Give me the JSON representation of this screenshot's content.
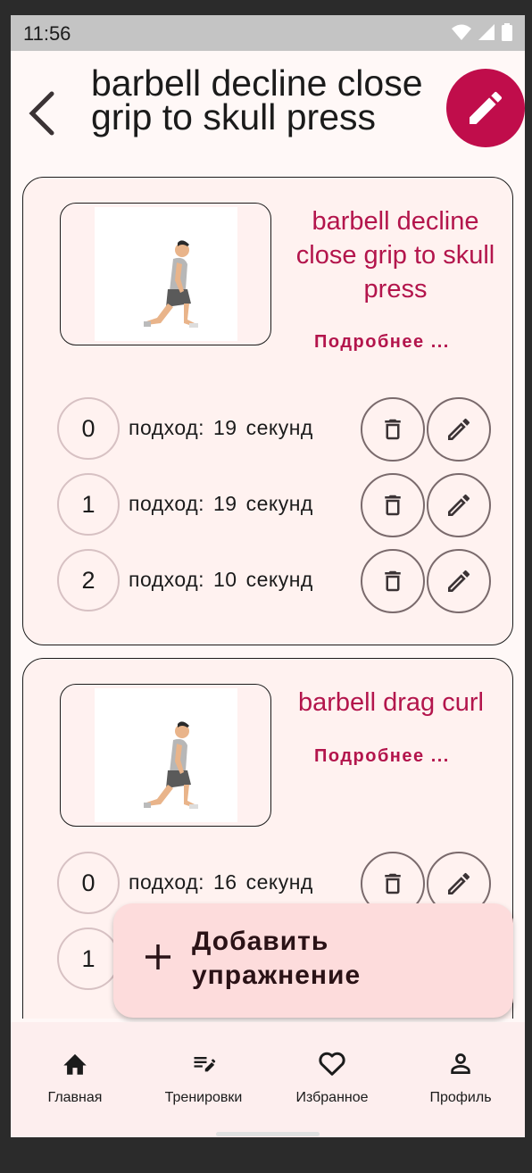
{
  "status_bar": {
    "time": "11:56"
  },
  "header": {
    "title": "barbell decline close grip to skull press"
  },
  "exercises": [
    {
      "name": "barbell decline close grip to skull press",
      "details_label": "Подробнее ...",
      "sets": [
        {
          "index": "0",
          "label": "подход:",
          "value": "19",
          "unit": "секунд"
        },
        {
          "index": "1",
          "label": "подход:",
          "value": "19",
          "unit": "секунд"
        },
        {
          "index": "2",
          "label": "подход:",
          "value": "10",
          "unit": "секунд"
        }
      ]
    },
    {
      "name": "barbell drag curl",
      "details_label": "Подробнее ...",
      "sets": [
        {
          "index": "0",
          "label": "подход:",
          "value": "16",
          "unit": "секунд"
        },
        {
          "index": "1",
          "label": "",
          "value": "",
          "unit": ""
        }
      ]
    }
  ],
  "add_button": {
    "label": "Добавить упражнение"
  },
  "nav": {
    "items": [
      {
        "label": "Главная",
        "icon": "home-icon"
      },
      {
        "label": "Тренировки",
        "icon": "workouts-icon"
      },
      {
        "label": "Избранное",
        "icon": "heart-icon"
      },
      {
        "label": "Профиль",
        "icon": "person-icon"
      }
    ]
  },
  "colors": {
    "accent": "#c00d4b",
    "card_bg": "#fff2f0",
    "fab_bg": "#fddcdc"
  }
}
